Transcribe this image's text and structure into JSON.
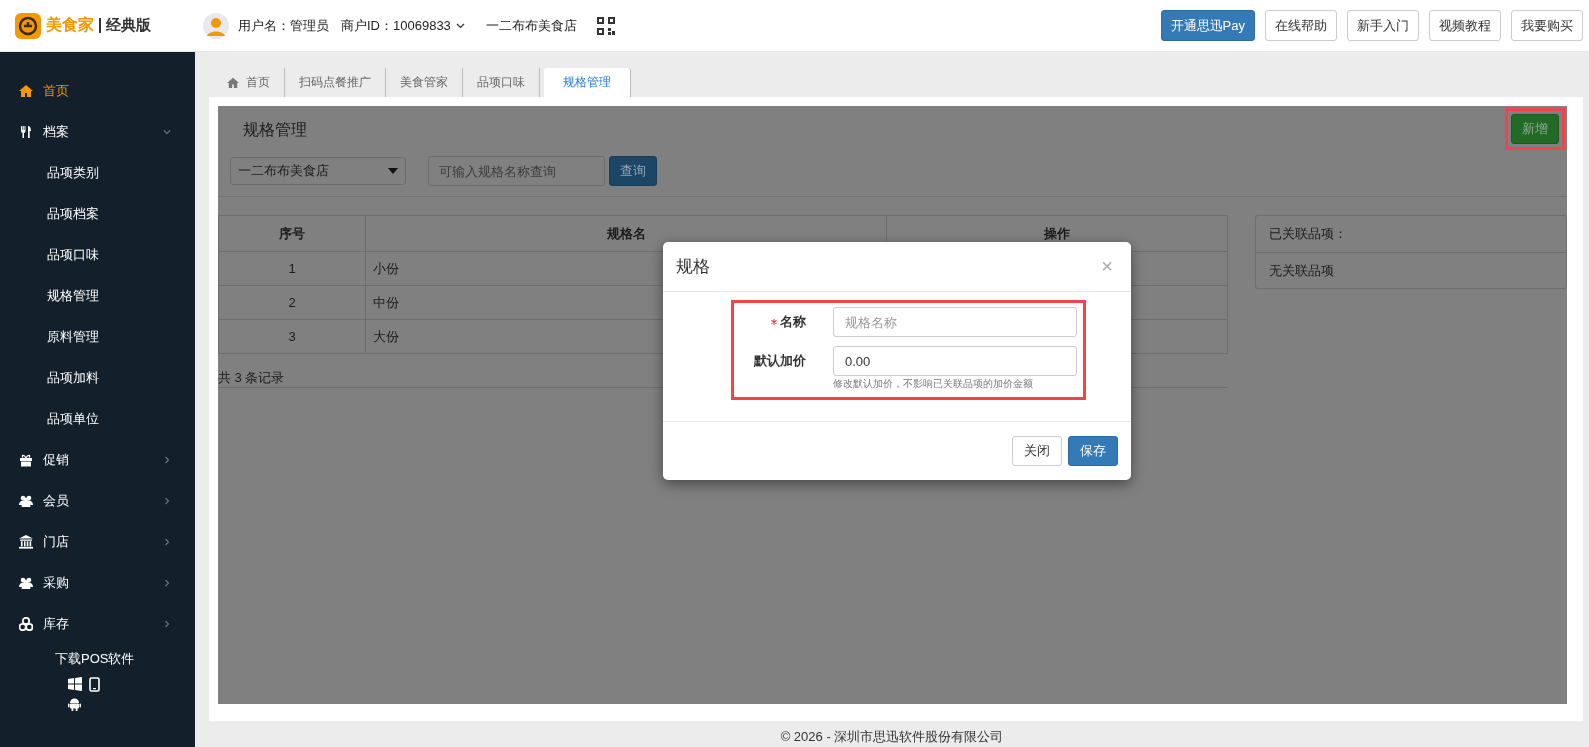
{
  "header": {
    "logo_text": "美食家",
    "edition": "经典版",
    "user": "用户名：管理员",
    "merchant_id": "商户ID：10069833",
    "store": "一二布布美食店",
    "buttons": [
      {
        "label": "开通思迅Pay",
        "kind": "primary"
      },
      {
        "label": "在线帮助",
        "kind": "default"
      },
      {
        "label": "新手入门",
        "kind": "default"
      },
      {
        "label": "视频教程",
        "kind": "default"
      },
      {
        "label": "我要购买",
        "kind": "default"
      }
    ]
  },
  "sidebar": {
    "items": [
      {
        "label": "首页",
        "kind": "link",
        "selected": true
      },
      {
        "label": "档案",
        "kind": "group",
        "selected": false,
        "expanded": true,
        "children": [
          {
            "label": "品项类别",
            "selected": false
          },
          {
            "label": "品项档案",
            "selected": false
          },
          {
            "label": "品项口味",
            "selected": false
          },
          {
            "label": "规格管理",
            "selected": false
          },
          {
            "label": "原料管理",
            "selected": false
          },
          {
            "label": "品项加料",
            "selected": false
          },
          {
            "label": "品项单位",
            "selected": false
          }
        ]
      },
      {
        "label": "促销",
        "kind": "group",
        "selected": false,
        "expanded": false
      },
      {
        "label": "会员",
        "kind": "group",
        "selected": false,
        "expanded": false
      },
      {
        "label": "门店",
        "kind": "group",
        "selected": false,
        "expanded": false
      },
      {
        "label": "采购",
        "kind": "group",
        "selected": false,
        "expanded": false
      },
      {
        "label": "库存",
        "kind": "group",
        "selected": false,
        "expanded": false
      }
    ],
    "download": {
      "label": "下载POS软件"
    }
  },
  "tabs": [
    {
      "label": "首页",
      "selected": false
    },
    {
      "label": "扫码点餐推广",
      "selected": false
    },
    {
      "label": "美食管家",
      "selected": false
    },
    {
      "label": "品项口味",
      "selected": false
    },
    {
      "label": "规格管理",
      "selected": true
    }
  ],
  "page": {
    "title": "规格管理",
    "add_button": "新增",
    "store_select": "一二布布美食店",
    "search_placeholder": "可输入规格名称查询",
    "search_button": "查询",
    "table": {
      "columns": [
        "序号",
        "规格名",
        "操作"
      ],
      "rows": [
        [
          "1",
          "小份"
        ],
        [
          "2",
          "中份"
        ],
        [
          "3",
          "大份"
        ]
      ]
    },
    "record_count": "共 3 条记录",
    "linked_panel": {
      "title": "已关联品项：",
      "empty_text": "无关联品项"
    }
  },
  "modal": {
    "title": "规格",
    "close": "×",
    "fields": [
      {
        "label": "名称",
        "required": true,
        "placeholder": "规格名称"
      },
      {
        "label": "默认加价",
        "required": false,
        "value": "0.00",
        "help": "修改默认加价，不影响已关联品项的加价金额"
      }
    ],
    "buttons": [
      {
        "label": "关闭",
        "kind": "default"
      },
      {
        "label": "保存",
        "kind": "primary"
      }
    ]
  },
  "footer": {
    "copyright": "© 2026 - 深圳市思迅软件股份有限公司"
  }
}
